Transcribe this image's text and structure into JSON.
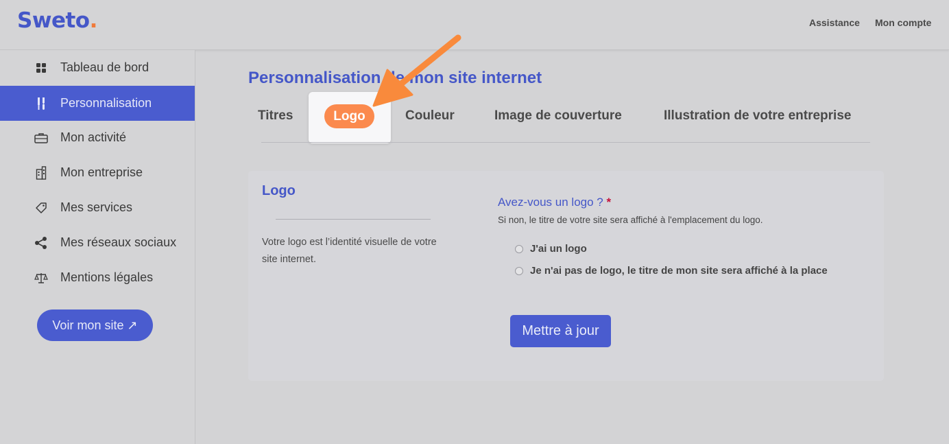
{
  "brand": {
    "name": "Sweto",
    "dot": ".",
    "accent_color": "#4557c8",
    "dot_color": "#f07a3a"
  },
  "header": {
    "links": [
      "Assistance",
      "Mon compte"
    ]
  },
  "sidebar": {
    "items": [
      {
        "label": "Tableau de bord",
        "icon": "dashboard-grid-icon"
      },
      {
        "label": "Personnalisation",
        "icon": "brushes-icon",
        "active": true
      },
      {
        "label": "Mon activité",
        "icon": "briefcase-icon"
      },
      {
        "label": "Mon entreprise",
        "icon": "building-icon"
      },
      {
        "label": "Mes services",
        "icon": "tag-icon"
      },
      {
        "label": "Mes réseaux sociaux",
        "icon": "share-icon"
      },
      {
        "label": "Mentions légales",
        "icon": "scale-icon"
      }
    ],
    "site_button": "Voir mon site ↗"
  },
  "main": {
    "title": "Personnalisation de mon site internet",
    "tabs": [
      "Titres",
      "Logo",
      "Couleur",
      "Image de couverture",
      "Illustration de votre entreprise"
    ],
    "active_tab": "Logo",
    "card": {
      "title": "Logo",
      "description": "Votre logo est l’identité visuelle de votre site internet.",
      "question": "Avez-vous un logo ?",
      "required_mark": "*",
      "hint": "Si non, le titre de votre site sera affiché à l'emplacement du logo.",
      "options": [
        "J'ai un logo",
        "Je n'ai pas de logo, le titre de mon site sera affiché à la place"
      ],
      "submit": "Mettre à jour"
    }
  },
  "annotation": {
    "arrow_color": "#f98a3c",
    "highlight_color": "#fb8a4e"
  }
}
